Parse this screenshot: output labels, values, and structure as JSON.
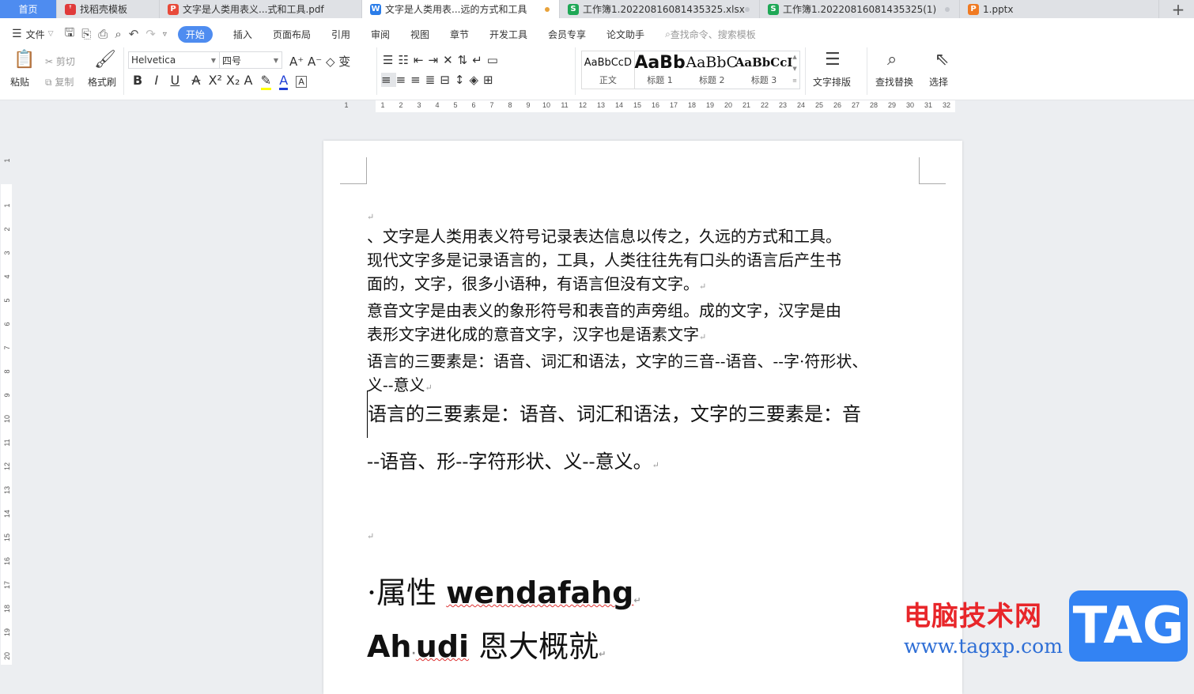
{
  "tabs": [
    {
      "label": "首页"
    },
    {
      "label": "找稻壳模板",
      "icon": "docer-icon",
      "color": "#e03a3a"
    },
    {
      "label": "文字是人类用表义...式和工具.pdf",
      "icon": "pdf-icon",
      "color": "#e84a3a"
    },
    {
      "label": "文字是人类用表...远的方式和工具",
      "icon": "writer-icon",
      "color": "#2b7de9"
    },
    {
      "label": "工作簿1.20220816081435325.xlsx",
      "icon": "sheet-icon",
      "color": "#1fa856"
    },
    {
      "label": "工作簿1.20220816081435325(1)",
      "icon": "sheet-icon",
      "color": "#1fa856"
    },
    {
      "label": "1.pptx",
      "icon": "ppt-icon",
      "color": "#f07a22"
    }
  ],
  "tab_glyphs": {
    "docer": "ꜛ",
    "pdf": "P",
    "writer": "W",
    "sheet": "S",
    "ppt": "P",
    "plus": "+"
  },
  "menu": {
    "file": "文件",
    "items": [
      "开始",
      "插入",
      "页面布局",
      "引用",
      "审阅",
      "视图",
      "章节",
      "开发工具",
      "会员专享",
      "论文助手"
    ],
    "search_placeholder": "查找命令、搜索模板"
  },
  "ribbon": {
    "paste": "粘贴",
    "cut": "剪切",
    "copy": "复制",
    "format_painter": "格式刷",
    "font": "Helvetica",
    "size": "四号",
    "text_layout": "文字排版",
    "find_replace": "查找替换",
    "select": "选择"
  },
  "styles": [
    {
      "sample": "AaBbCcD",
      "label": "正文"
    },
    {
      "sample": "AaBb",
      "label": "标题 1"
    },
    {
      "sample": "AaBbC",
      "label": "标题 2"
    },
    {
      "sample": "AaBbCcI",
      "label": "标题 3"
    }
  ],
  "ruler": {
    "h": [
      "1",
      "1",
      "2",
      "3",
      "4",
      "5",
      "6",
      "7",
      "8",
      "9",
      "10",
      "11",
      "12",
      "13",
      "14",
      "15",
      "16",
      "17",
      "18",
      "19",
      "20",
      "21",
      "22",
      "23",
      "24",
      "25",
      "26",
      "27",
      "28",
      "29",
      "30",
      "31",
      "32"
    ],
    "v": [
      "1",
      "1",
      "2",
      "3",
      "4",
      "5",
      "6",
      "7",
      "8",
      "9",
      "10",
      "11",
      "12",
      "13",
      "14",
      "15",
      "16",
      "17",
      "18",
      "19",
      "20"
    ]
  },
  "document": {
    "mark": "↵",
    "lines": [
      "、文字是人类用表义符号记录表达信息以传之，久远的方式和工具。",
      "现代文字多是记录语言的，工具，人类往往先有口头的语言后产生书",
      "面的，文字，很多小语种，有语言但没有文字。",
      "意音文字是由表义的象形符号和表音的声旁组。成的文字，汉字是由",
      "表形文字进化成的意音文字，汉字也是语素文字",
      "语言的三要素是：语音、词汇和语法，文字的三音--语音、--字·符形状、",
      "义--意义"
    ],
    "line_marks": [
      false,
      false,
      true,
      false,
      true,
      false,
      true
    ],
    "large_lines": [
      "语言的三要素是：语音、词汇和语法，文字的三要素是：音",
      "--语音、形--字符形状、义--意义。"
    ],
    "title1_prefix": "·属性 ",
    "title1_word": "wendafahg",
    "title2_a": "Ah",
    "title2_dot": "·",
    "title2_b": "udi",
    "title2_c": " 恩大概就"
  },
  "watermark": {
    "cn": "电脑技术网",
    "url": "www.tagxp.com",
    "tag": "TAG"
  }
}
